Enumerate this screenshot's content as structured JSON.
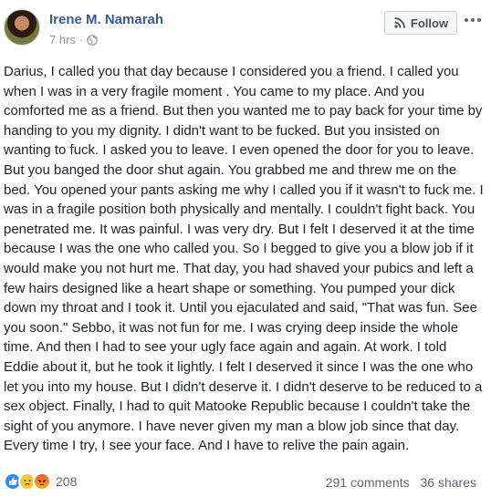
{
  "post": {
    "author": "Irene M. Namarah",
    "time": "7 hrs",
    "separator": "·",
    "privacy_icon": "globe-icon",
    "follow_label": "Follow",
    "body": "Darius, I called you that day because I considered you a friend. I called you when I was in a very fragile moment . You came to my place. And you comforted me as a friend. But then you wanted me to pay back for your time by handing to you my dignity. I didn't want to be fucked. But you insisted on wanting to fuck. I asked you to leave. I even opened the door for you to leave. But you banged the door shut again. You grabbed me and threw me on the bed. You opened your pants asking me why I called you if it wasn't to fuck me. I was in a fragile position both physically and mentally. I couldn't fight back. You penetrated me. It was painful. I was very dry. But I felt I deserved it at the time because I was the one who called you. So I begged to give you a blow job if it would make you not hurt me. That day, you had shaved your pubics and left a few hairs designed like a heart shape or something. You pumped your dick down my throat and I took it. Until you ejaculated and said, \"That was fun. See you soon.\" Sebbo, it was not fun for me. I was crying deep inside the whole time. And then I had to see your ugly face again and again. At work. I told Eddie about it, but he took it lightly. I felt I deserved it since I was the one who let you into my house. But I didn't deserve it. I didn't deserve to be reduced to a sex object. Finally, I had to quit Matooke Republic because I couldn't take the sight of you anymore. I have never given my man a blow job since that day. Every time I try, I see your face. And I have to relive the pain again."
  },
  "footer": {
    "reaction_icons": [
      "like-icon",
      "sad-icon",
      "angry-icon"
    ],
    "reaction_count": "208",
    "comments": "291 comments",
    "shares": "36 shares"
  },
  "colors": {
    "author": "#385898",
    "text": "#1d2129",
    "meta": "#90949c",
    "like": "#2d88ff"
  }
}
